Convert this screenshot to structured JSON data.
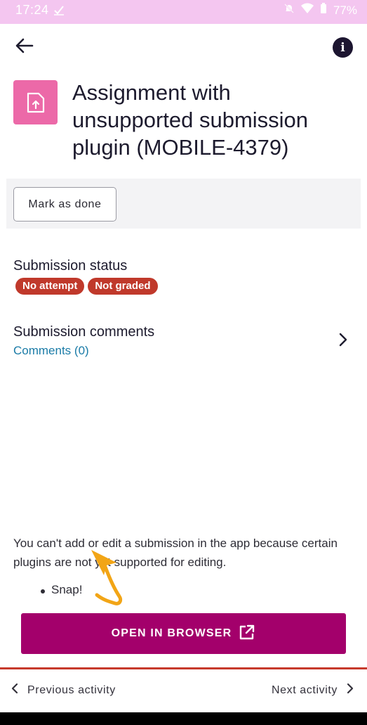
{
  "status_bar": {
    "time": "17:24",
    "battery": "77%"
  },
  "header": {
    "back_icon": "arrow-left-icon",
    "info_icon": "info-icon"
  },
  "activity": {
    "icon": "assignment-upload-icon",
    "icon_color": "#ec69a8",
    "title": "Assignment with unsupported submission plugin (MOBILE-4379)"
  },
  "completion": {
    "mark_done_label": "Mark as done"
  },
  "submission_status": {
    "title": "Submission status",
    "badges": [
      "No attempt",
      "Not graded"
    ],
    "badge_color": "#c0392b"
  },
  "comments": {
    "title": "Submission comments",
    "link": "Comments (0)"
  },
  "notice": {
    "text": "You can't add or edit a submission in the app because certain plugins are not yet supported for editing.",
    "plugins": [
      "Snap!"
    ]
  },
  "open_browser": {
    "label": "OPEN IN BROWSER",
    "color": "#a3006b"
  },
  "bottom_nav": {
    "prev_label": "Previous activity",
    "next_label": "Next activity"
  }
}
